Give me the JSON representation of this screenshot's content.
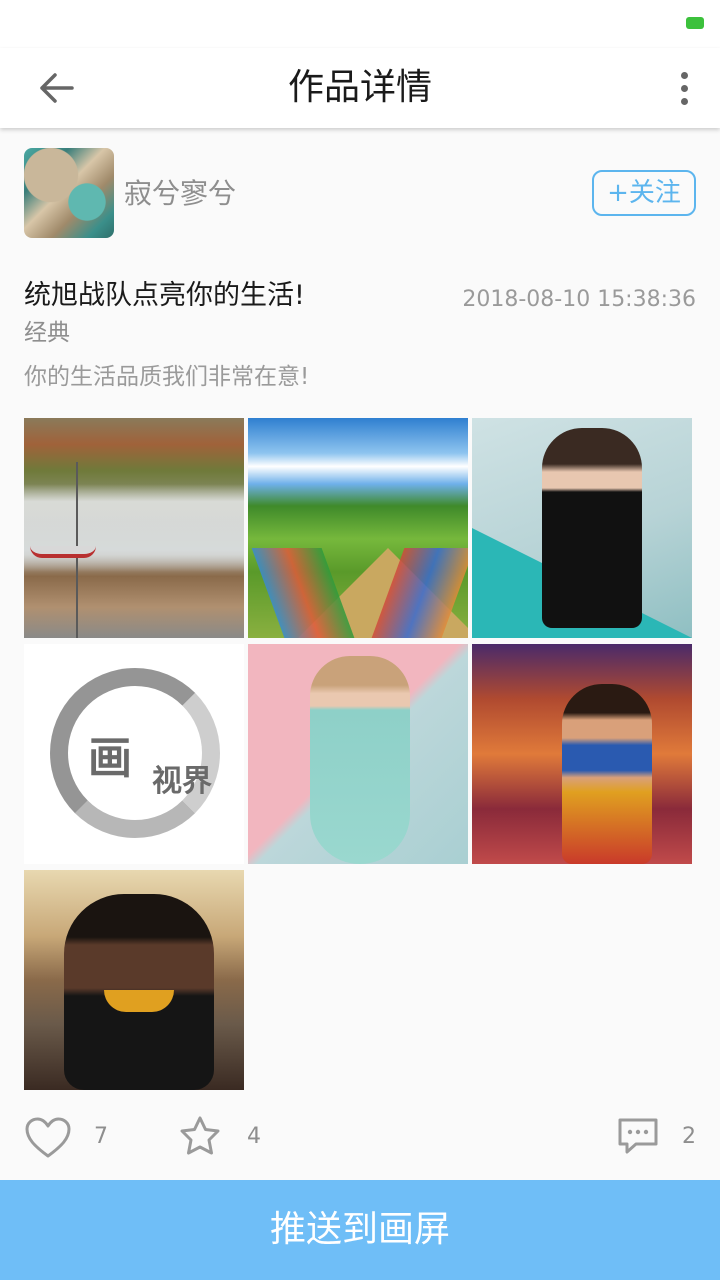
{
  "header": {
    "title": "作品详情"
  },
  "author": {
    "name": "寂兮寥兮",
    "follow_label": "+关注"
  },
  "post": {
    "title": "统旭战队点亮你的生活!",
    "time": "2018-08-10 15:38:36",
    "category": "经典",
    "description": "你的生活品质我们非常在意!"
  },
  "gallery": {
    "logo_text": "画",
    "logo_text_small": "视界"
  },
  "stats": {
    "likes": "7",
    "favorites": "4",
    "comments": "2"
  },
  "footer": {
    "push_label": "推送到画屏"
  },
  "colors": {
    "accent": "#6fbef7",
    "follow_border": "#5cb5ee",
    "battery": "#3cc13c"
  },
  "icons": {
    "back": "arrow-left-icon",
    "more": "more-vertical-icon",
    "like": "heart-icon",
    "favorite": "star-icon",
    "comment": "comment-icon"
  }
}
